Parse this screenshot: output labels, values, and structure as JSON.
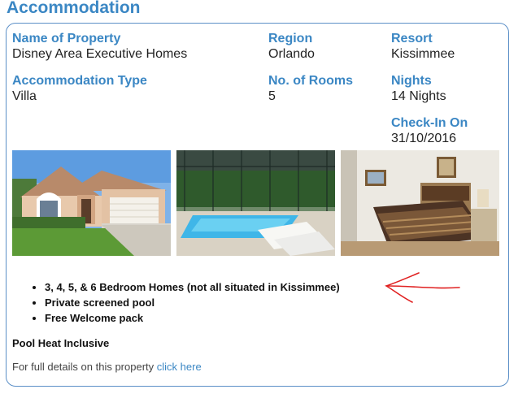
{
  "section_title": "Accommodation",
  "fields": {
    "property_name": {
      "label": "Name of Property",
      "value": "Disney Area Executive Homes"
    },
    "region": {
      "label": "Region",
      "value": "Orlando"
    },
    "resort": {
      "label": "Resort",
      "value": "Kissimmee"
    },
    "accommodation_type": {
      "label": "Accommodation Type",
      "value": "Villa"
    },
    "rooms": {
      "label": "No. of Rooms",
      "value": "5"
    },
    "nights": {
      "label": "Nights",
      "value": "14 Nights"
    },
    "check_in": {
      "label": "Check-In On",
      "value": "31/10/2016"
    }
  },
  "features": [
    "3, 4, 5, & 6 Bedroom Homes (not all situated in Kissimmee)",
    "Private screened pool",
    "Free Welcome pack"
  ],
  "pool_heat": "Pool Heat Inclusive",
  "details": {
    "prefix": "For full details on this property",
    "link": "click here"
  },
  "colors": {
    "accent": "#3b87c4",
    "border": "#5b8fc7",
    "annotation": "#e02020"
  }
}
